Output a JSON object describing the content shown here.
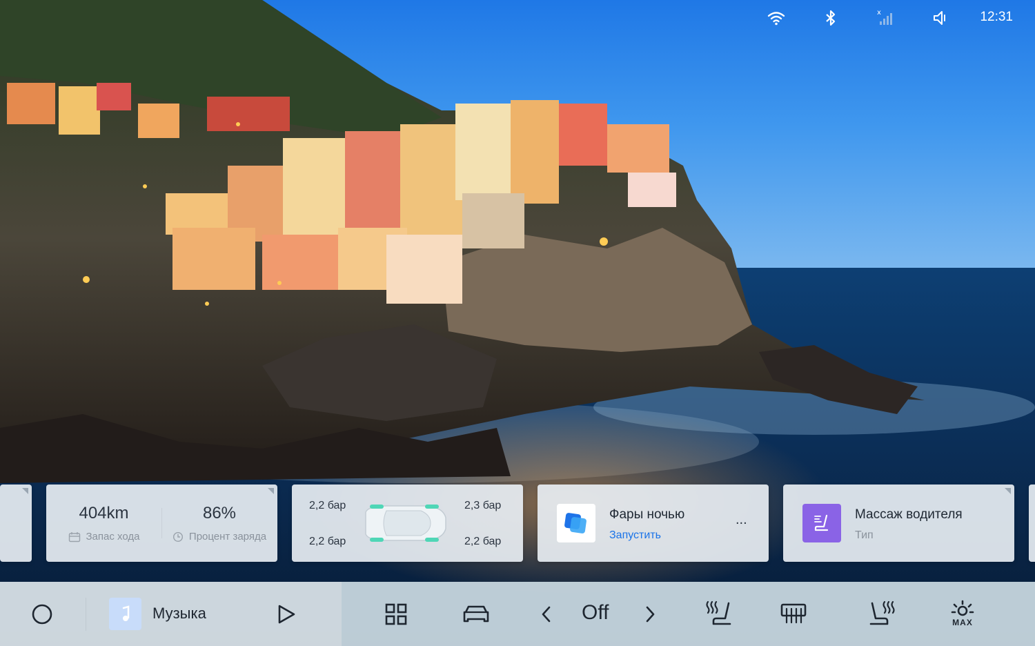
{
  "status_bar": {
    "wifi_icon": "wifi-icon",
    "bluetooth_icon": "bluetooth-icon",
    "signal_icon": "cellular-signal-icon",
    "volume_icon": "volume-muted-icon",
    "time": "12:31"
  },
  "range_card": {
    "range_value": "404km",
    "range_label": "Запас хода",
    "charge_value": "86%",
    "charge_label": "Процент заряда"
  },
  "tire_card": {
    "front_left": "2,2 бар",
    "front_right": "2,3 бар",
    "rear_left": "2,2 бар",
    "rear_right": "2,2 бар"
  },
  "lights_card": {
    "title": "Фары ночью",
    "action": "Запустить",
    "more": "...",
    "accent": "#1a73e8"
  },
  "massage_card": {
    "title": "Массаж водителя",
    "subtitle": "Тип",
    "accent": "#8a63e6"
  },
  "dock": {
    "music_label": "Музыка",
    "fan_mode": "Off",
    "max_label": "MAX"
  }
}
